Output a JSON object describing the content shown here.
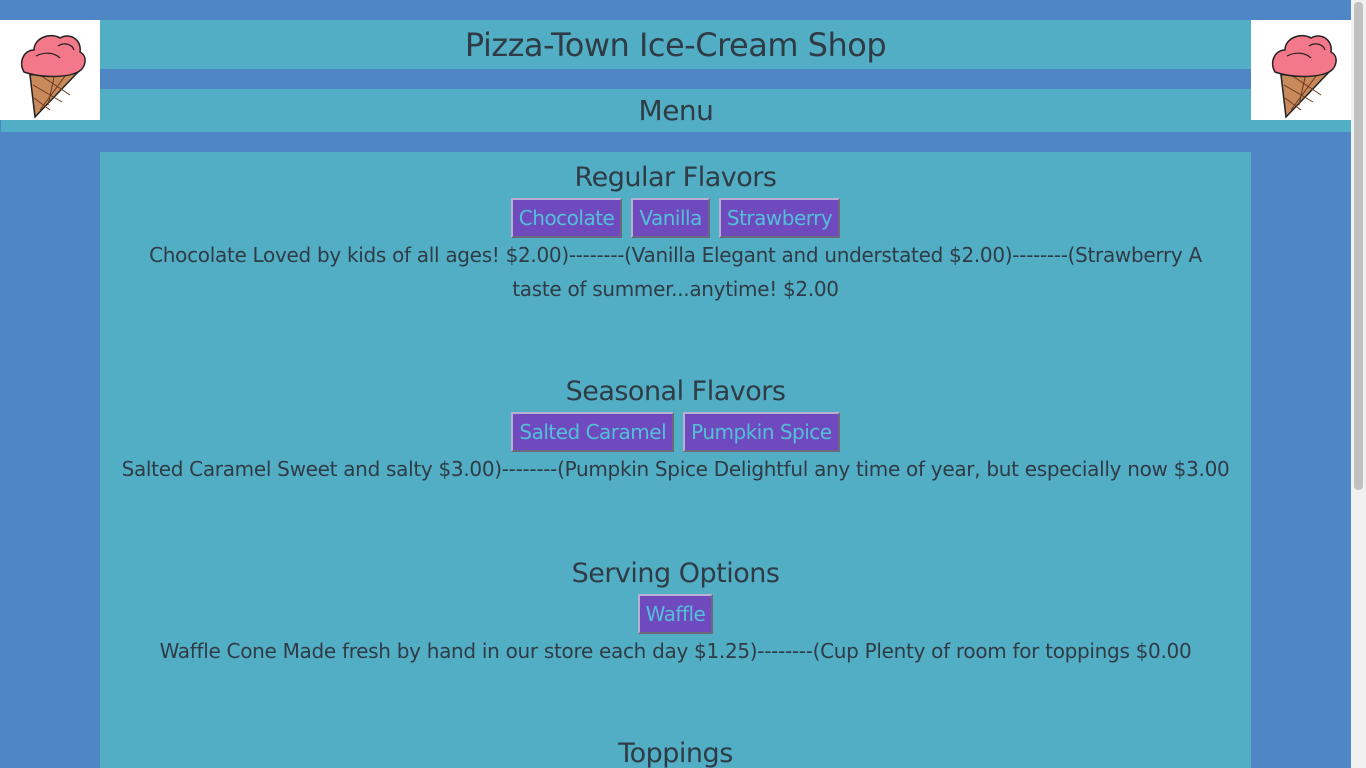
{
  "header": {
    "title": "Pizza-Town Ice-Cream Shop",
    "menu_label": "Menu"
  },
  "sections": {
    "regular": {
      "title": "Regular Flavors",
      "buttons": [
        "Chocolate",
        "Vanilla",
        "Strawberry"
      ],
      "description": "Chocolate Loved by kids of all ages! $2.00)--------(Vanilla Elegant and understated $2.00)--------(Strawberry A taste of summer...anytime! $2.00"
    },
    "seasonal": {
      "title": "Seasonal Flavors",
      "buttons": [
        "Salted Caramel",
        "Pumpkin Spice"
      ],
      "description": "Salted Caramel Sweet and salty $3.00)--------(Pumpkin Spice Delightful any time of year, but especially now $3.00"
    },
    "serving": {
      "title": "Serving Options",
      "buttons": [
        "Waffle"
      ],
      "description": "Waffle Cone Made fresh by hand in our store each day $1.25)--------(Cup Plenty of room for toppings $0.00"
    },
    "toppings": {
      "title": "Toppings"
    }
  },
  "colors": {
    "background": "#4f86c6",
    "panel": "#52aec5",
    "button_bg": "#6f4abf",
    "button_text": "#52c1d8",
    "text": "#2f3b45"
  },
  "icons": {
    "logo_left": "ice-cream-cone-icon",
    "logo_right": "ice-cream-cone-icon"
  }
}
